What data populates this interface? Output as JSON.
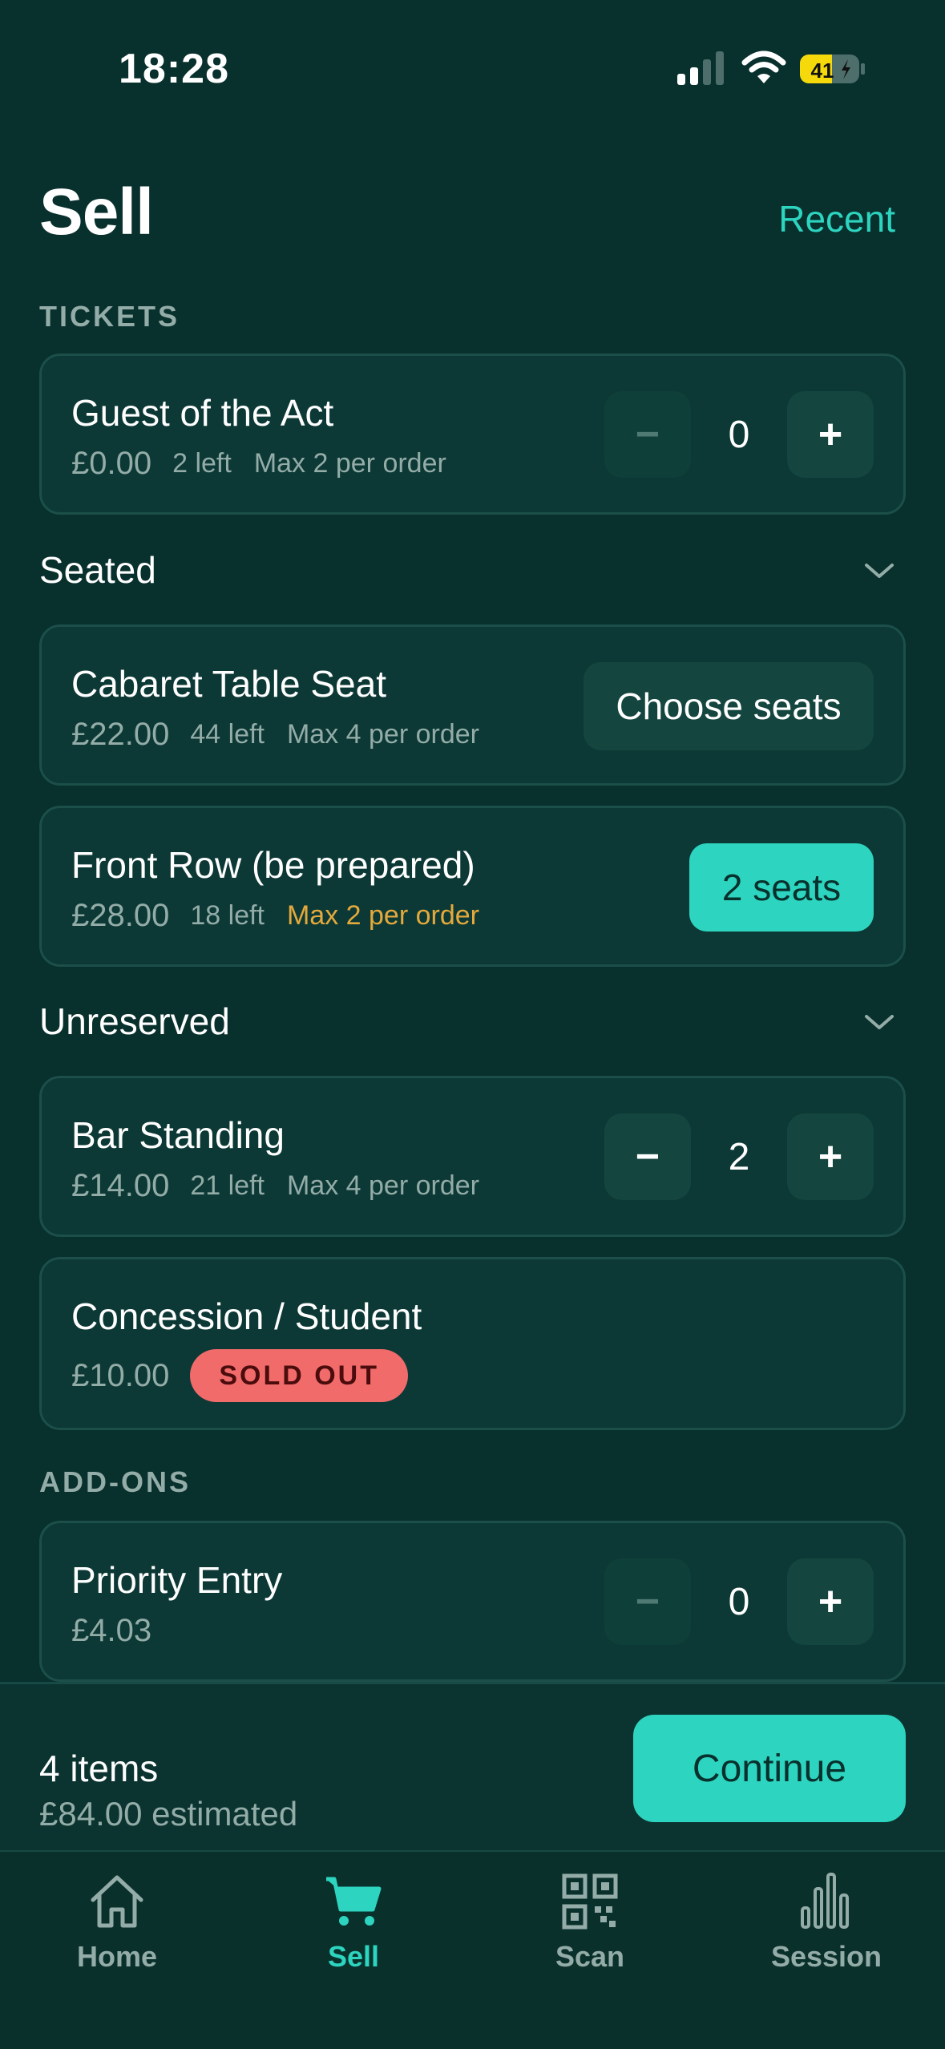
{
  "status_bar": {
    "time": "18:28",
    "battery": "41"
  },
  "header": {
    "title": "Sell",
    "recent_label": "Recent"
  },
  "sections": {
    "tickets_label": "TICKETS",
    "seated_label": "Seated",
    "unreserved_label": "Unreserved",
    "addons_label": "ADD-ONS"
  },
  "tickets": [
    {
      "name": "Guest of the Act",
      "price": "£0.00",
      "left": "2 left",
      "max": "Max 2 per order",
      "quantity": "0",
      "minus": "−",
      "plus": "+"
    }
  ],
  "seated": [
    {
      "name": "Cabaret Table Seat",
      "price": "£22.00",
      "left": "44 left",
      "max": "Max 4 per order",
      "action": "Choose seats"
    },
    {
      "name": "Front Row (be prepared)",
      "price": "£28.00",
      "left": "18 left",
      "max": "Max 2 per order",
      "action": "2 seats"
    }
  ],
  "unreserved": [
    {
      "name": "Bar Standing",
      "price": "£14.00",
      "left": "21 left",
      "max": "Max 4 per order",
      "quantity": "2",
      "minus": "−",
      "plus": "+"
    },
    {
      "name": "Concession / Student",
      "price": "£10.00",
      "badge": "SOLD OUT"
    }
  ],
  "addons": [
    {
      "name": "Priority Entry",
      "price": "£4.03",
      "quantity": "0",
      "minus": "−",
      "plus": "+"
    }
  ],
  "checkout": {
    "items": "4 items",
    "estimate": "£84.00 estimated",
    "continue_label": "Continue"
  },
  "tabs": [
    {
      "label": "Home",
      "icon": "home-icon"
    },
    {
      "label": "Sell",
      "icon": "cart-icon",
      "active": true
    },
    {
      "label": "Scan",
      "icon": "qr-icon"
    },
    {
      "label": "Session",
      "icon": "bar-chart-icon"
    }
  ],
  "colors": {
    "background": "#08302d",
    "accent": "#2dd4bf",
    "warning": "#e4a93c",
    "sold_out": "#f26b6b",
    "battery": "#f5d90a"
  }
}
